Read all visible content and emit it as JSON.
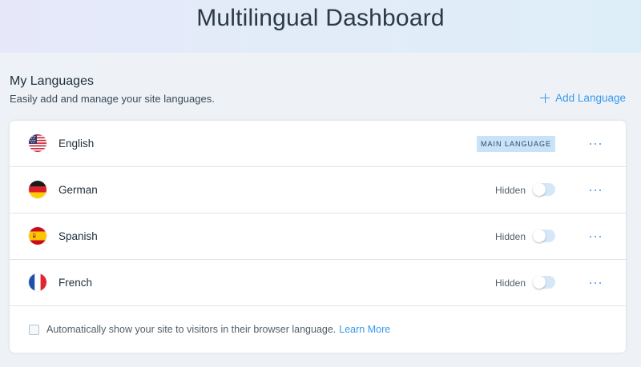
{
  "header": {
    "title": "Multilingual Dashboard"
  },
  "section": {
    "title": "My Languages",
    "subtitle": "Easily add and manage your site languages.",
    "add_label": "Add Language"
  },
  "languages": [
    {
      "name": "English",
      "flag": "us-flag-icon",
      "badge": "MAIN LANGUAGE"
    },
    {
      "name": "German",
      "flag": "germany-flag-icon",
      "status": "Hidden",
      "visible": false
    },
    {
      "name": "Spanish",
      "flag": "spain-flag-icon",
      "status": "Hidden",
      "visible": false
    },
    {
      "name": "French",
      "flag": "france-flag-icon",
      "status": "Hidden",
      "visible": false
    }
  ],
  "footer": {
    "auto_text": "Automatically show your site to visitors in their browser language.",
    "learn_more": "Learn More",
    "checked": false
  },
  "colors": {
    "accent": "#3899ec",
    "badge_bg": "#c9e2f7",
    "page_bg": "#eef2f6"
  }
}
